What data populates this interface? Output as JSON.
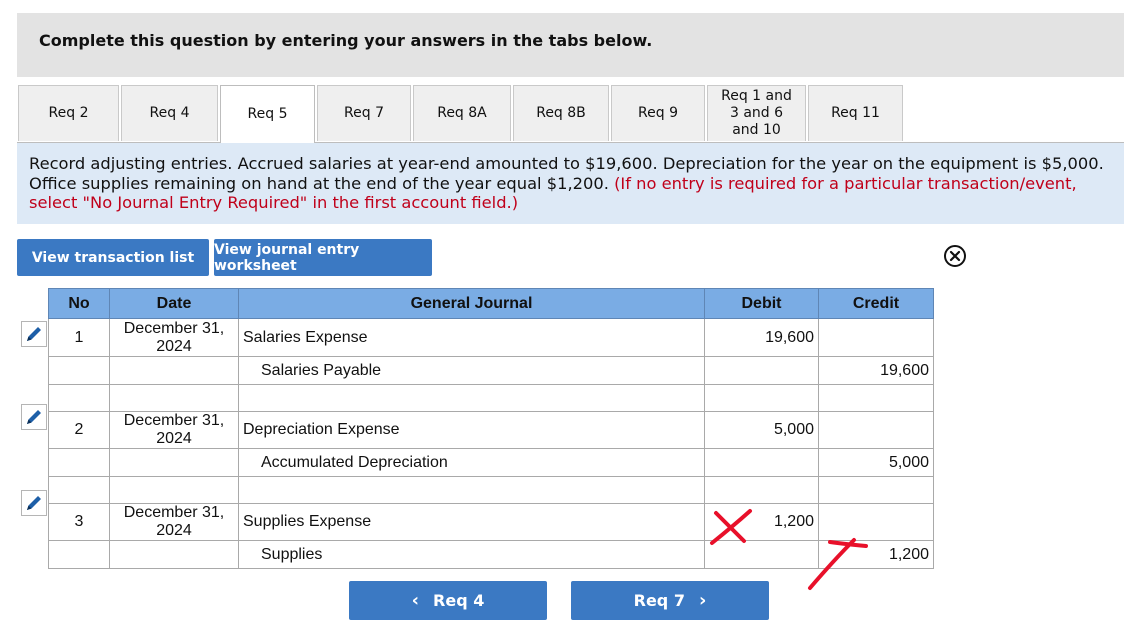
{
  "header": {
    "title": "Complete this question by entering your answers in the tabs below."
  },
  "tabs": [
    {
      "label": "Req 2",
      "active": false
    },
    {
      "label": "Req 4",
      "active": false
    },
    {
      "label": "Req 5",
      "active": true
    },
    {
      "label": "Req 7",
      "active": false
    },
    {
      "label": "Req 8A",
      "active": false
    },
    {
      "label": "Req 8B",
      "active": false
    },
    {
      "label": "Req 9",
      "active": false
    },
    {
      "label": "Req 1 and 3 and 6 and 10",
      "active": false
    },
    {
      "label": "Req 11",
      "active": false
    }
  ],
  "instructions": {
    "text": "Record adjusting entries. Accrued salaries at year-end amounted to $19,600. Depreciation for the year on the equipment is $5,000. Office supplies remaining on hand at the end of the year equal $1,200.",
    "note": "(If no entry is required for a particular transaction/event, select \"No Journal Entry Required\" in the first account field.)"
  },
  "buttons": {
    "view_transaction_list": "View transaction list",
    "view_journal_worksheet": "View journal entry worksheet"
  },
  "journal": {
    "headers": {
      "no": "No",
      "date": "Date",
      "account": "General Journal",
      "debit": "Debit",
      "credit": "Credit"
    },
    "entries": [
      {
        "no": "1",
        "date": "December 31, 2024",
        "debit_account": "Salaries Expense",
        "debit": "19,600",
        "credit_account": "Salaries Payable",
        "credit": "19,600"
      },
      {
        "no": "2",
        "date": "December 31, 2024",
        "debit_account": "Depreciation Expense",
        "debit": "5,000",
        "credit_account": "Accumulated Depreciation",
        "credit": "5,000"
      },
      {
        "no": "3",
        "date": "December 31, 2024",
        "debit_account": "Supplies Expense",
        "debit": "1,200",
        "credit_account": "Supplies",
        "credit": "1,200"
      }
    ]
  },
  "nav": {
    "prev_label": "Req 4",
    "next_label": "Req 7"
  },
  "colors": {
    "accent": "#3b79c3",
    "table_header": "#7aace4",
    "instruction_bg": "#dde9f6",
    "note_red": "#c0001a",
    "mark_red": "#e8102a"
  },
  "icons": [
    "pencil-icon",
    "close-circle-icon",
    "chevron-left-icon",
    "chevron-right-icon",
    "x-mark"
  ]
}
